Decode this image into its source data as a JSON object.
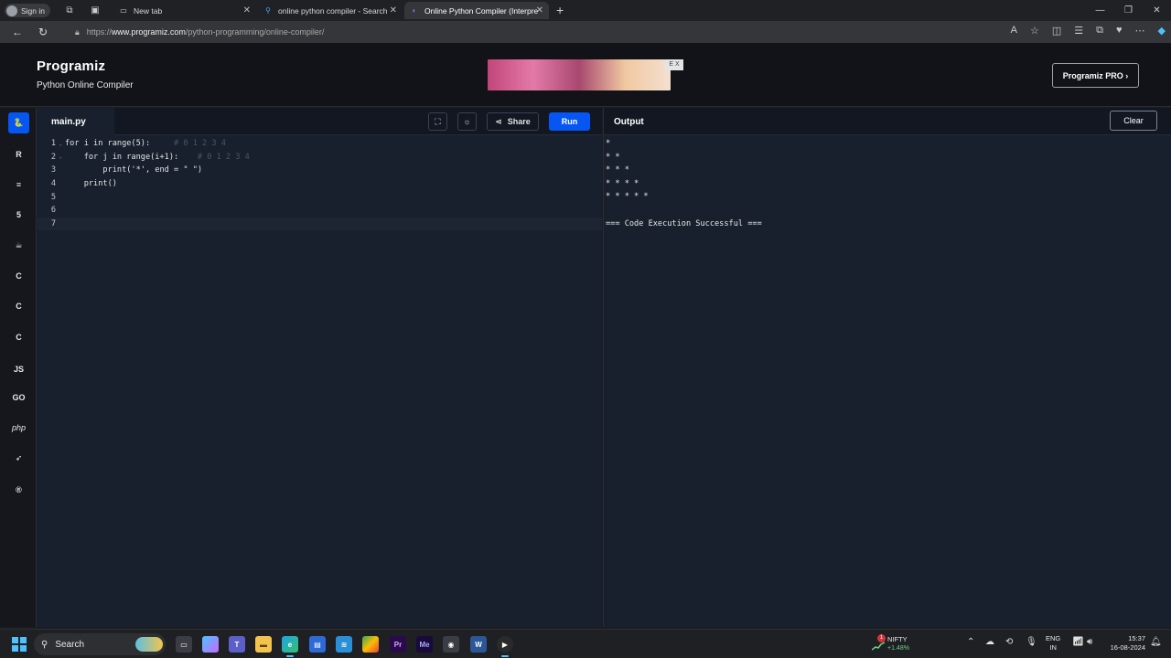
{
  "browser": {
    "signin_label": "Sign in",
    "tabs": [
      {
        "title": "New tab",
        "icon": "page-icon"
      },
      {
        "title": "online python compiler - Search",
        "icon": "search-icon"
      },
      {
        "title": "Online Python Compiler (Interpre",
        "icon": "programiz-icon"
      }
    ],
    "url_prefix": "https://",
    "url_domain": "www.programiz.com",
    "url_path": "/python-programming/online-compiler/"
  },
  "site": {
    "logo": "Programiz",
    "subtitle": "Python Online Compiler",
    "pro_button": "Programiz PRO ›",
    "ad_badge": "E X"
  },
  "rail": {
    "items": [
      {
        "name": "python",
        "label": "🐍"
      },
      {
        "name": "r",
        "label": "R"
      },
      {
        "name": "sql",
        "label": "≡"
      },
      {
        "name": "html",
        "label": "5"
      },
      {
        "name": "java",
        "label": "☕"
      },
      {
        "name": "c",
        "label": "C"
      },
      {
        "name": "cpp",
        "label": "C"
      },
      {
        "name": "csharp",
        "label": "C"
      },
      {
        "name": "js",
        "label": "JS"
      },
      {
        "name": "go",
        "label": "GO"
      },
      {
        "name": "php",
        "label": "php"
      },
      {
        "name": "swift",
        "label": "➶"
      },
      {
        "name": "rust",
        "label": "®"
      }
    ]
  },
  "editor": {
    "filename": "main.py",
    "share_label": "Share",
    "run_label": "Run",
    "lines": [
      {
        "num": "1",
        "fold": true,
        "code": "for i in range(5):",
        "comment": "     # 0 1 2 3 4"
      },
      {
        "num": "2",
        "fold": true,
        "code": "    for j in range(i+1):",
        "comment": "    # 0 1 2 3 4"
      },
      {
        "num": "3",
        "fold": false,
        "code": "        print('*', end = \" \")",
        "comment": ""
      },
      {
        "num": "4",
        "fold": false,
        "code": "    print()",
        "comment": ""
      },
      {
        "num": "5",
        "fold": false,
        "code": "",
        "comment": ""
      },
      {
        "num": "6",
        "fold": false,
        "code": "",
        "comment": ""
      },
      {
        "num": "7",
        "fold": false,
        "code": "",
        "comment": ""
      }
    ]
  },
  "output": {
    "title": "Output",
    "clear_label": "Clear",
    "lines": [
      "*",
      "* *",
      "* * *",
      "* * * *",
      "* * * * *",
      "",
      "=== Code Execution Successful ==="
    ]
  },
  "taskbar": {
    "search_label": "Search",
    "nifty_label": "NIFTY",
    "nifty_change": "+1.48%",
    "nifty_badge": "1",
    "lang_1": "ENG",
    "lang_2": "IN",
    "time": "15:37",
    "date": "16-08-2024"
  },
  "colors": {
    "accent": "#0556f3",
    "editor_bg": "#18202e",
    "header_bg": "#111318"
  }
}
